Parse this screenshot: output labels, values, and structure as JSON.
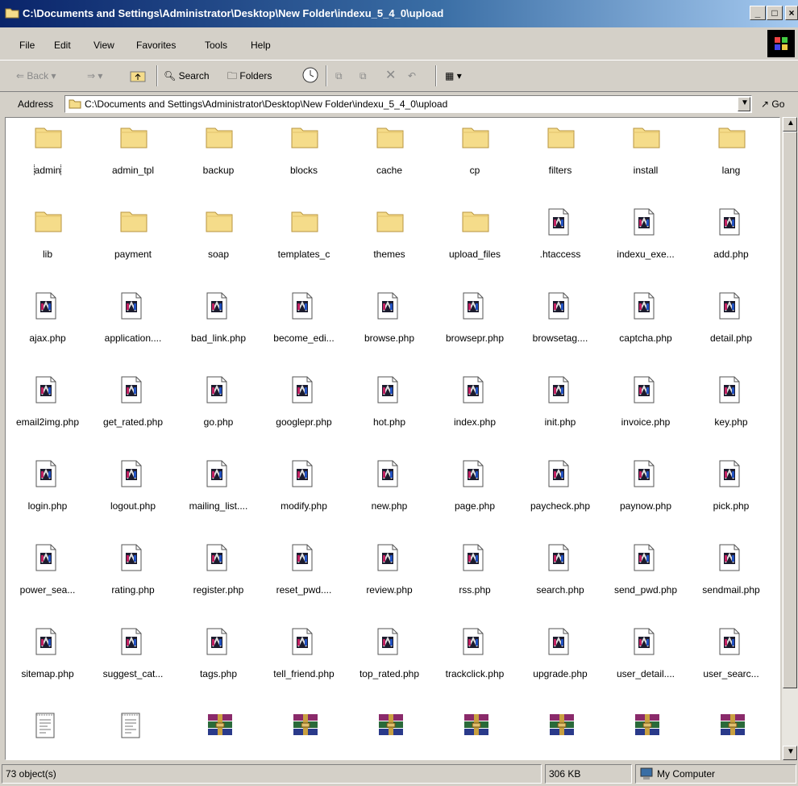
{
  "window": {
    "title": "C:\\Documents and Settings\\Administrator\\Desktop\\New Folder\\indexu_5_4_0\\upload",
    "minimize_label": "_",
    "maximize_label": "□",
    "close_label": "×"
  },
  "menu": [
    "File",
    "Edit",
    "View",
    "Favorites",
    "Tools",
    "Help"
  ],
  "toolbar": {
    "back_label": "Back",
    "search_label": "Search",
    "folders_label": "Folders"
  },
  "address": {
    "label": "Address",
    "value": "C:\\Documents and Settings\\Administrator\\Desktop\\New Folder\\indexu_5_4_0\\upload",
    "go_label": "Go"
  },
  "files": [
    {
      "name": "admin",
      "type": "folder"
    },
    {
      "name": "admin_tpl",
      "type": "folder"
    },
    {
      "name": "backup",
      "type": "folder"
    },
    {
      "name": "blocks",
      "type": "folder"
    },
    {
      "name": "cache",
      "type": "folder"
    },
    {
      "name": "cp",
      "type": "folder"
    },
    {
      "name": "filters",
      "type": "folder"
    },
    {
      "name": "install",
      "type": "folder"
    },
    {
      "name": "lang",
      "type": "folder"
    },
    {
      "name": "lib",
      "type": "folder"
    },
    {
      "name": "payment",
      "type": "folder"
    },
    {
      "name": "soap",
      "type": "folder"
    },
    {
      "name": "templates_c",
      "type": "folder"
    },
    {
      "name": "themes",
      "type": "folder"
    },
    {
      "name": "upload_files",
      "type": "folder"
    },
    {
      "name": ".htaccess",
      "type": "script"
    },
    {
      "name": "indexu_exe...",
      "type": "script"
    },
    {
      "name": "add.php",
      "type": "script"
    },
    {
      "name": "ajax.php",
      "type": "script"
    },
    {
      "name": "application....",
      "type": "script"
    },
    {
      "name": "bad_link.php",
      "type": "script"
    },
    {
      "name": "become_edi...",
      "type": "script"
    },
    {
      "name": "browse.php",
      "type": "script"
    },
    {
      "name": "browsepr.php",
      "type": "script"
    },
    {
      "name": "browsetag....",
      "type": "script"
    },
    {
      "name": "captcha.php",
      "type": "script"
    },
    {
      "name": "detail.php",
      "type": "script"
    },
    {
      "name": "email2img.php",
      "type": "script"
    },
    {
      "name": "get_rated.php",
      "type": "script"
    },
    {
      "name": "go.php",
      "type": "script"
    },
    {
      "name": "googlepr.php",
      "type": "script"
    },
    {
      "name": "hot.php",
      "type": "script"
    },
    {
      "name": "index.php",
      "type": "script"
    },
    {
      "name": "init.php",
      "type": "script"
    },
    {
      "name": "invoice.php",
      "type": "script"
    },
    {
      "name": "key.php",
      "type": "script"
    },
    {
      "name": "login.php",
      "type": "script"
    },
    {
      "name": "logout.php",
      "type": "script"
    },
    {
      "name": "mailing_list....",
      "type": "script"
    },
    {
      "name": "modify.php",
      "type": "script"
    },
    {
      "name": "new.php",
      "type": "script"
    },
    {
      "name": "page.php",
      "type": "script"
    },
    {
      "name": "paycheck.php",
      "type": "script"
    },
    {
      "name": "paynow.php",
      "type": "script"
    },
    {
      "name": "pick.php",
      "type": "script"
    },
    {
      "name": "power_sea...",
      "type": "script"
    },
    {
      "name": "rating.php",
      "type": "script"
    },
    {
      "name": "register.php",
      "type": "script"
    },
    {
      "name": "reset_pwd....",
      "type": "script"
    },
    {
      "name": "review.php",
      "type": "script"
    },
    {
      "name": "rss.php",
      "type": "script"
    },
    {
      "name": "search.php",
      "type": "script"
    },
    {
      "name": "send_pwd.php",
      "type": "script"
    },
    {
      "name": "sendmail.php",
      "type": "script"
    },
    {
      "name": "sitemap.php",
      "type": "script"
    },
    {
      "name": "suggest_cat...",
      "type": "script"
    },
    {
      "name": "tags.php",
      "type": "script"
    },
    {
      "name": "tell_friend.php",
      "type": "script"
    },
    {
      "name": "top_rated.php",
      "type": "script"
    },
    {
      "name": "trackclick.php",
      "type": "script"
    },
    {
      "name": "upgrade.php",
      "type": "script"
    },
    {
      "name": "user_detail....",
      "type": "script"
    },
    {
      "name": "user_searc...",
      "type": "script"
    },
    {
      "name": "",
      "type": "text"
    },
    {
      "name": "",
      "type": "text"
    },
    {
      "name": "",
      "type": "archive"
    },
    {
      "name": "",
      "type": "archive"
    },
    {
      "name": "",
      "type": "archive"
    },
    {
      "name": "",
      "type": "archive"
    },
    {
      "name": "",
      "type": "archive"
    },
    {
      "name": "",
      "type": "archive"
    },
    {
      "name": "",
      "type": "archive"
    }
  ],
  "focused_item": "admin",
  "status": {
    "objects": "73 object(s)",
    "size": "306 KB",
    "zone": "My Computer"
  },
  "colors": {
    "folder": "#f5dc8a",
    "titlebar_start": "#0a246a",
    "titlebar_end": "#a6caf0"
  }
}
